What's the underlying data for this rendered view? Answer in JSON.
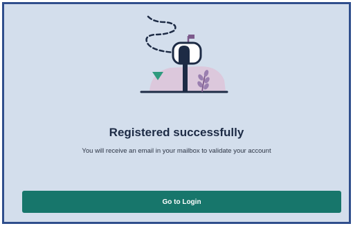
{
  "message": {
    "title": "Registered successfully",
    "subtitle": "You will receive an email in your mailbox to validate your account"
  },
  "actions": {
    "login_label": "Go to Login"
  },
  "illustration": {
    "icon": "mailbox-illustration-icon"
  },
  "colors": {
    "frame_border": "#2f4e8c",
    "background": "#d3deec",
    "button": "#17766b",
    "title_text": "#1d2b45"
  }
}
